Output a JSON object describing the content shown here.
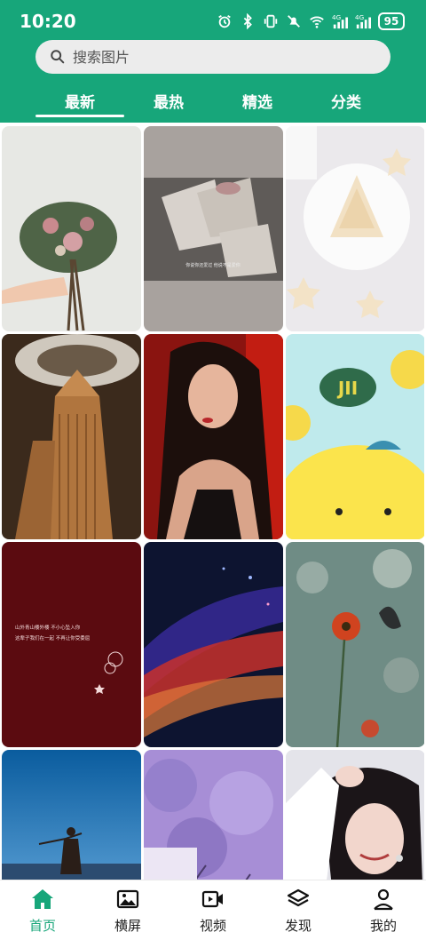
{
  "status_bar": {
    "time": "10:20",
    "battery": "95",
    "icons": [
      "alarm-icon",
      "bluetooth-icon",
      "vibrate-icon",
      "mute-icon",
      "wifi-icon",
      "signal-4g-icon",
      "signal-4g-icon"
    ]
  },
  "search": {
    "placeholder": "搜索图片",
    "value": ""
  },
  "tabs": [
    {
      "label": "最新",
      "active": true
    },
    {
      "label": "最热",
      "active": false
    },
    {
      "label": "精选",
      "active": false
    },
    {
      "label": "分类",
      "active": false
    }
  ],
  "grid": {
    "tiles": [
      {
        "subject": "hand holding flower bouquet"
      },
      {
        "subject": "bouquet wrapped in paper with caption"
      },
      {
        "subject": "star cookies on plate"
      },
      {
        "subject": "architectural tower interior"
      },
      {
        "subject": "portrait of woman"
      },
      {
        "subject": "cartoon character illustration"
      },
      {
        "subject": "dark red with handwritten text"
      },
      {
        "subject": "colorful light streaks"
      },
      {
        "subject": "red flowers and butterfly"
      },
      {
        "subject": "woman on beach at dusk"
      },
      {
        "subject": "purple tree blossoms"
      },
      {
        "subject": "smiling woman portrait"
      }
    ],
    "tile_text": {
      "tile2_caption": "你说你还爱过 他说不是爱你",
      "tile6_label": "JII",
      "tile7_line1": "山外青山楼外楼 不小心坠入你",
      "tile7_line2": "这辈子我们在一起 不再让你受委屈"
    }
  },
  "bottom_nav": [
    {
      "label": "首页",
      "icon": "home-icon",
      "active": true
    },
    {
      "label": "横屏",
      "icon": "image-icon",
      "active": false
    },
    {
      "label": "视频",
      "icon": "video-icon",
      "active": false
    },
    {
      "label": "发现",
      "icon": "layers-icon",
      "active": false
    },
    {
      "label": "我的",
      "icon": "user-icon",
      "active": false
    }
  ],
  "colors": {
    "primary": "#17a67a",
    "nav_active": "#17a67a",
    "search_bg": "#ececec"
  }
}
